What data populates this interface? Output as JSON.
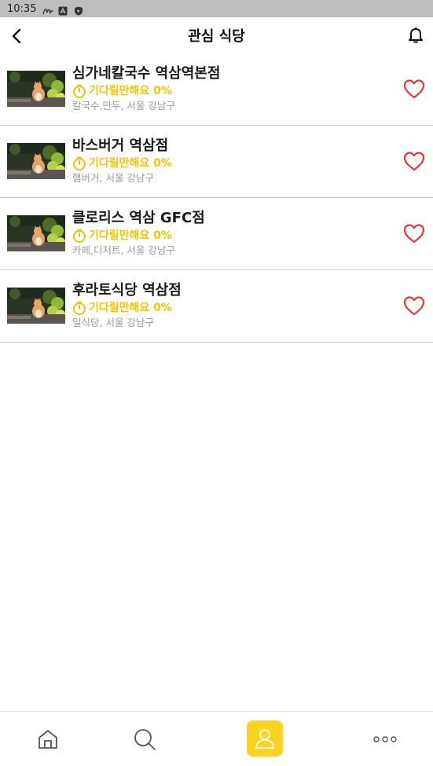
{
  "status_bar": {
    "time": "10:35",
    "icons": [
      "app-notification-icon",
      "a-letter-icon",
      "shield-icon"
    ]
  },
  "header": {
    "title": "관심 식당",
    "back_icon": "chevron-left-icon",
    "bell_icon": "bell-icon"
  },
  "restaurants": [
    {
      "name": "심가네칼국수 역삼역본점",
      "wait": "기다릴만해요 0%",
      "category": "칼국수,만두, 서울 강남구",
      "favorited": true
    },
    {
      "name": "바스버거 역삼점",
      "wait": "기다릴만해요 0%",
      "category": "햄버거, 서울 강남구",
      "favorited": true
    },
    {
      "name": "클로리스 역삼 GFC점",
      "wait": "기다릴만해요 0%",
      "category": "카페,디저트, 서울 강남구",
      "favorited": true
    },
    {
      "name": "후라토식당 역삼점",
      "wait": "기다릴만해요 0%",
      "category": "일식당, 서울 강남구",
      "favorited": true
    }
  ],
  "bottom_nav": {
    "items": [
      "home-icon",
      "search-icon",
      "profile-icon",
      "more-icon"
    ],
    "active": "profile-icon"
  },
  "colors": {
    "accent_yellow": "#ffd21f",
    "wait_text": "#f5c400",
    "heart": "#e53935"
  }
}
